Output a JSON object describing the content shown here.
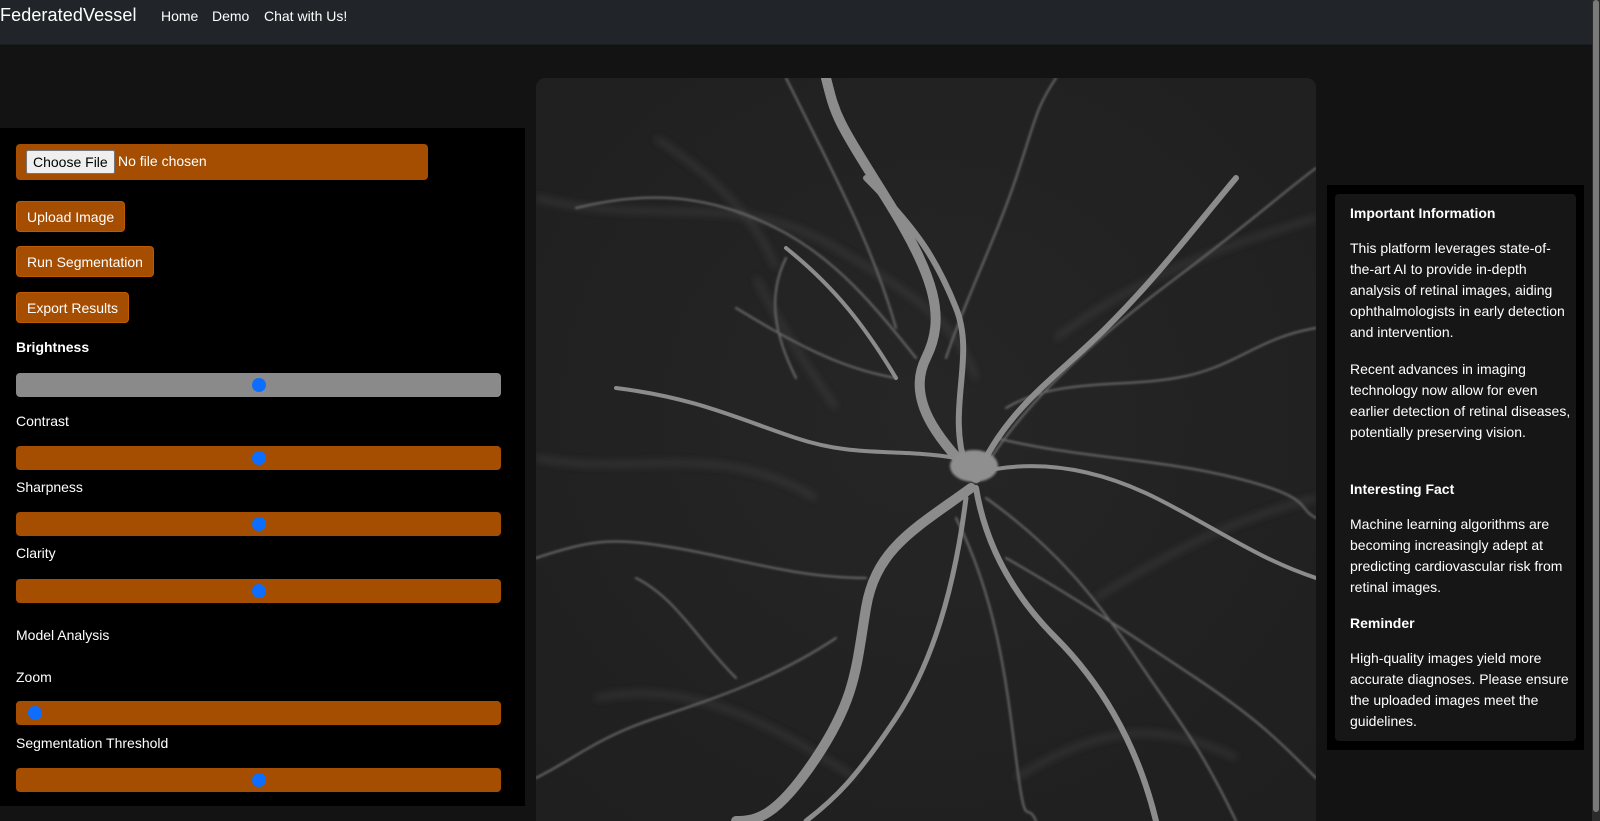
{
  "navbar": {
    "brand": "FederatedVessel",
    "links": [
      "Home",
      "Demo",
      "Chat with Us!"
    ]
  },
  "controls": {
    "file_button": "Choose File",
    "file_status": "No file chosen",
    "upload_label": "Upload Image",
    "segment_label": "Run Segmentation",
    "export_label": "Export Results",
    "brightness_label": "Brightness",
    "contrast_label": "Contrast",
    "sharpness_label": "Sharpness",
    "clarity_label": "Clarity",
    "model_analysis_label": "Model Analysis",
    "zoom_label": "Zoom",
    "threshold_label": "Segmentation Threshold",
    "slider_values": {
      "brightness": 0.5,
      "contrast": 0.5,
      "sharpness": 0.5,
      "clarity": 0.5,
      "zoom": 0.04,
      "threshold": 0.5
    }
  },
  "info": {
    "important_title": "Important Information",
    "important_p1": "This platform leverages state-of-the-art AI to provide in-depth analysis of retinal images, aiding ophthalmologists in early detection and intervention.",
    "important_p2": "Recent advances in imaging technology now allow for even earlier detection of retinal diseases, potentially preserving vision.",
    "fact_title": "Interesting Fact",
    "fact_p": "Machine learning algorithms are becoming increasingly adept at predicting cardiovascular risk from retinal images.",
    "reminder_title": "Reminder",
    "reminder_p": "High-quality images yield more accurate diagnoses. Please ensure the uploaded images meet the guidelines."
  },
  "colors": {
    "accent": "#a54d00",
    "thumb": "#0d6efd",
    "navbar": "#212529"
  }
}
